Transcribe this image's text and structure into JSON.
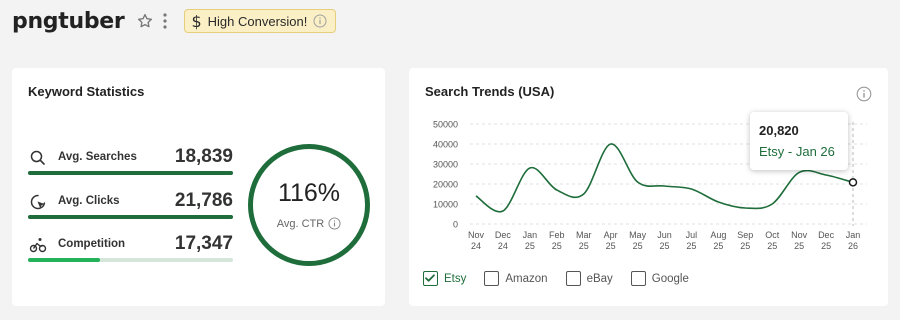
{
  "header": {
    "title": "pngtuber",
    "badge_label": "High Conversion!"
  },
  "keyword_stats": {
    "title": "Keyword Statistics",
    "rows": [
      {
        "label": "Avg. Searches",
        "value": "18,839",
        "fill": 1.0
      },
      {
        "label": "Avg. Clicks",
        "value": "21,786",
        "fill": 1.0
      },
      {
        "label": "Competition",
        "value": "17,347",
        "fill": 0.35
      }
    ],
    "ctr_value": "116%",
    "ctr_label": "Avg. CTR"
  },
  "trends": {
    "title": "Search Trends (USA)",
    "tooltip_value": "20,820",
    "tooltip_label": "Etsy - Jan 26",
    "legend": [
      {
        "label": "Etsy",
        "checked": true
      },
      {
        "label": "Amazon",
        "checked": false
      },
      {
        "label": "eBay",
        "checked": false
      },
      {
        "label": "Google",
        "checked": false
      }
    ]
  },
  "colors": {
    "accent": "#1e6d3b",
    "bar_fill": "#1e6d3b",
    "competition_fill": "#23b15a",
    "bar_track": "#d4e6d9",
    "badge_bg": "#fbefc6"
  },
  "chart_data": {
    "type": "line",
    "y_ticks": [
      "50000",
      "40000",
      "30000",
      "20000",
      "10000",
      "0"
    ],
    "ylim": [
      0,
      50000
    ],
    "x_labels": [
      [
        "Nov",
        "24"
      ],
      [
        "Dec",
        "24"
      ],
      [
        "Jan",
        "25"
      ],
      [
        "Feb",
        "25"
      ],
      [
        "Mar",
        "25"
      ],
      [
        "Apr",
        "25"
      ],
      [
        "May",
        "25"
      ],
      [
        "Jun",
        "25"
      ],
      [
        "Jul",
        "25"
      ],
      [
        "Aug",
        "25"
      ],
      [
        "Sep",
        "25"
      ],
      [
        "Oct",
        "25"
      ],
      [
        "Nov",
        "25"
      ],
      [
        "Dec",
        "25"
      ],
      [
        "Jan",
        "26"
      ]
    ],
    "series": [
      {
        "values": [
          14000,
          6500,
          28000,
          17000,
          15000,
          40000,
          21000,
          19000,
          17500,
          11000,
          8000,
          10000,
          25800,
          24500,
          20820
        ]
      }
    ],
    "grid": true
  }
}
